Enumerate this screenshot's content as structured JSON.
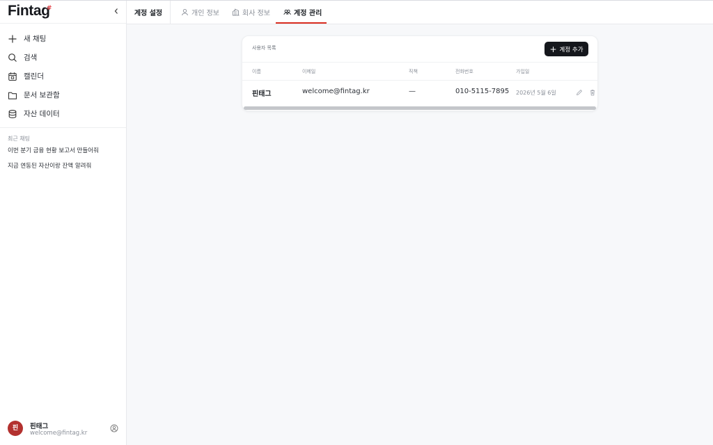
{
  "app": {
    "logo": "Fintag",
    "logo_mark": "#"
  },
  "sidebar": {
    "items": [
      {
        "label": "새 채팅",
        "icon": "plus-icon"
      },
      {
        "label": "검색",
        "icon": "search-icon"
      },
      {
        "label": "캘린더",
        "icon": "calendar-icon"
      },
      {
        "label": "문서 보관함",
        "icon": "folder-icon"
      },
      {
        "label": "자산 데이터",
        "icon": "database-icon"
      }
    ],
    "recent_label": "최근 채팅",
    "recent": [
      "이번 분기 금융 현황 보고서 만들어줘",
      "지금 연동된 자산이랑 잔액 알려줘"
    ],
    "user": {
      "initial": "핀",
      "name": "핀태그",
      "email": "welcome@fintag.kr"
    }
  },
  "tabs": {
    "title": "계정 설정",
    "items": [
      {
        "label": "개인 정보",
        "icon": "user-icon"
      },
      {
        "label": "회사 정보",
        "icon": "building-icon"
      },
      {
        "label": "계정 관리",
        "icon": "users-icon"
      }
    ],
    "active_index": 2
  },
  "card": {
    "title": "사용자 목록",
    "add_button": "계정 추가",
    "columns": [
      "이름",
      "이메일",
      "직책",
      "전화번호",
      "가입일"
    ],
    "rows": [
      {
        "name": "핀태그",
        "email": "welcome@fintag.kr",
        "position": "—",
        "phone": "010-5115-7895",
        "joined": "2026년 5월 6일"
      }
    ]
  },
  "colors": {
    "accent": "#d92d20",
    "button": "#15171c",
    "avatar": "#b3312f"
  }
}
